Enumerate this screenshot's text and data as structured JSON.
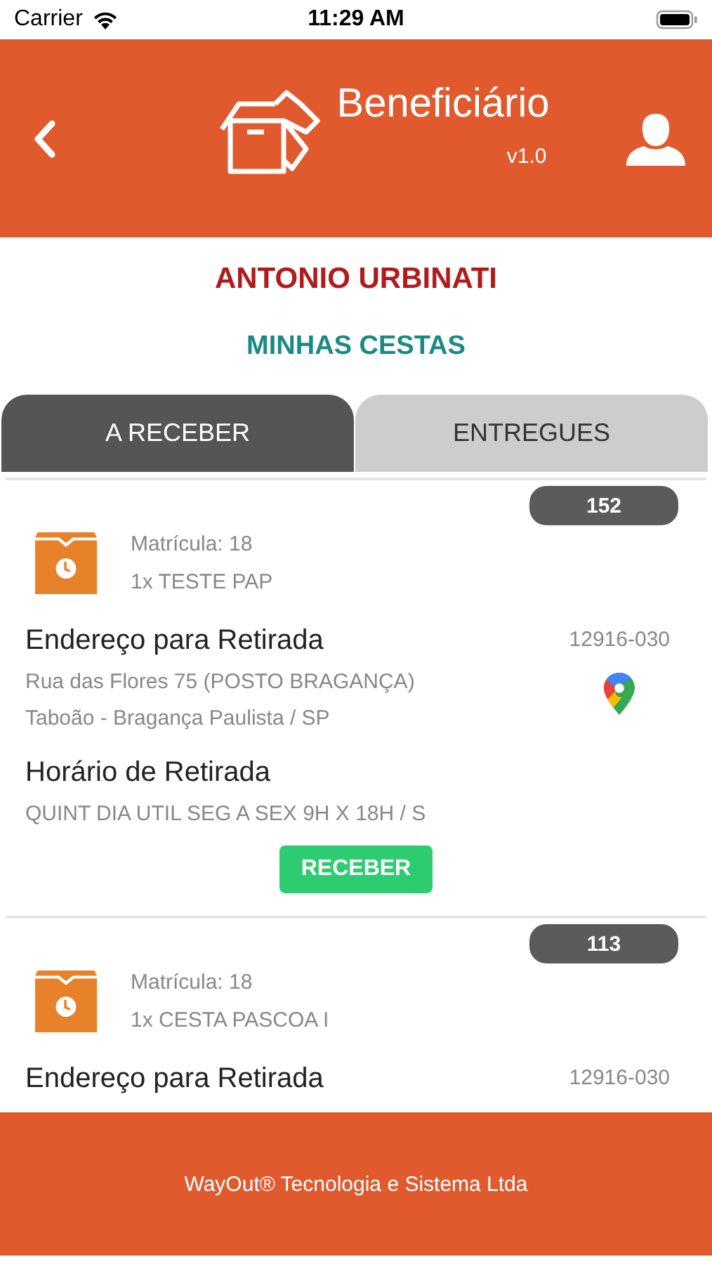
{
  "status_bar": {
    "carrier": "Carrier",
    "time": "11:29 AM"
  },
  "header": {
    "title": "Beneficiário",
    "version": "v1.0"
  },
  "user_name": "ANTONIO URBINATI",
  "section_title": "MINHAS CESTAS",
  "tabs": [
    {
      "label": "A RECEBER",
      "selected": true
    },
    {
      "label": "ENTREGUES",
      "selected": false
    }
  ],
  "cards": [
    {
      "badge": "152",
      "matricula": "Matrícula: 18",
      "item": "1x TESTE PAP",
      "address_heading": "Endereço para Retirada",
      "cep": "12916-030",
      "address_lines": [
        "Rua das Flores 75 (POSTO BRAGANÇA)",
        "Taboão - Bragança Paulista / SP"
      ],
      "schedule_heading": "Horário de Retirada",
      "schedule": "QUINT DIA UTIL SEG A SEX 9H X 18H / S",
      "button": "RECEBER"
    },
    {
      "badge": "113",
      "matricula": "Matrícula: 18",
      "item": "1x CESTA PASCOA I",
      "address_heading": "Endereço para Retirada",
      "cep": "12916-030"
    }
  ],
  "footer": "WayOut® Tecnologia e Sistema Ltda"
}
